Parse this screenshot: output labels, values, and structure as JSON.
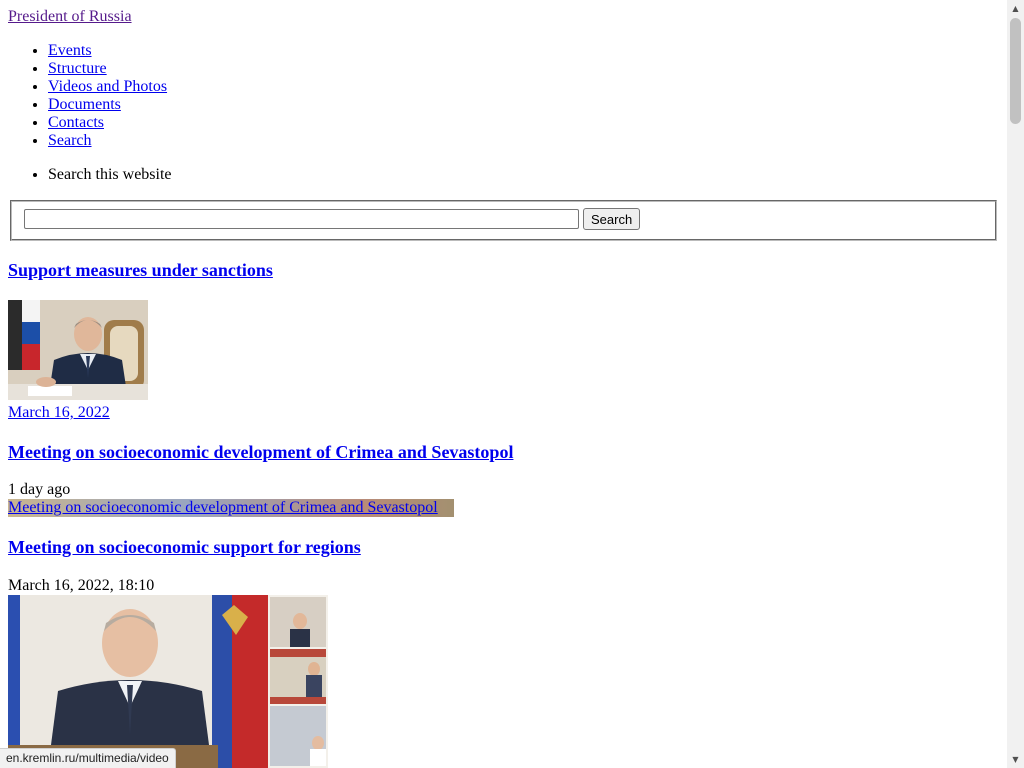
{
  "site": {
    "title": "President of Russia"
  },
  "nav": {
    "items": [
      {
        "label": "Events"
      },
      {
        "label": "Structure"
      },
      {
        "label": "Videos and Photos"
      },
      {
        "label": "Documents"
      },
      {
        "label": "Contacts"
      },
      {
        "label": "Search"
      }
    ]
  },
  "search": {
    "label": "Search this website",
    "value": "",
    "button_label": "Search"
  },
  "articles": [
    {
      "title": "Support measures under sanctions",
      "date": "March 16, 2022"
    },
    {
      "title": "Meeting on socioeconomic development of Crimea and Sevastopol",
      "date": "1 day ago",
      "image_alt": "Meeting on socioeconomic development of Crimea and Sevastopol"
    },
    {
      "title": "Meeting on socioeconomic support for regions",
      "date": "March 16, 2022, 18:10"
    }
  ],
  "status_bar": {
    "url": "en.kremlin.ru/multimedia/video"
  },
  "icons": {
    "scroll_up": "scroll-up-arrow-icon",
    "scroll_down": "scroll-down-arrow-icon"
  }
}
